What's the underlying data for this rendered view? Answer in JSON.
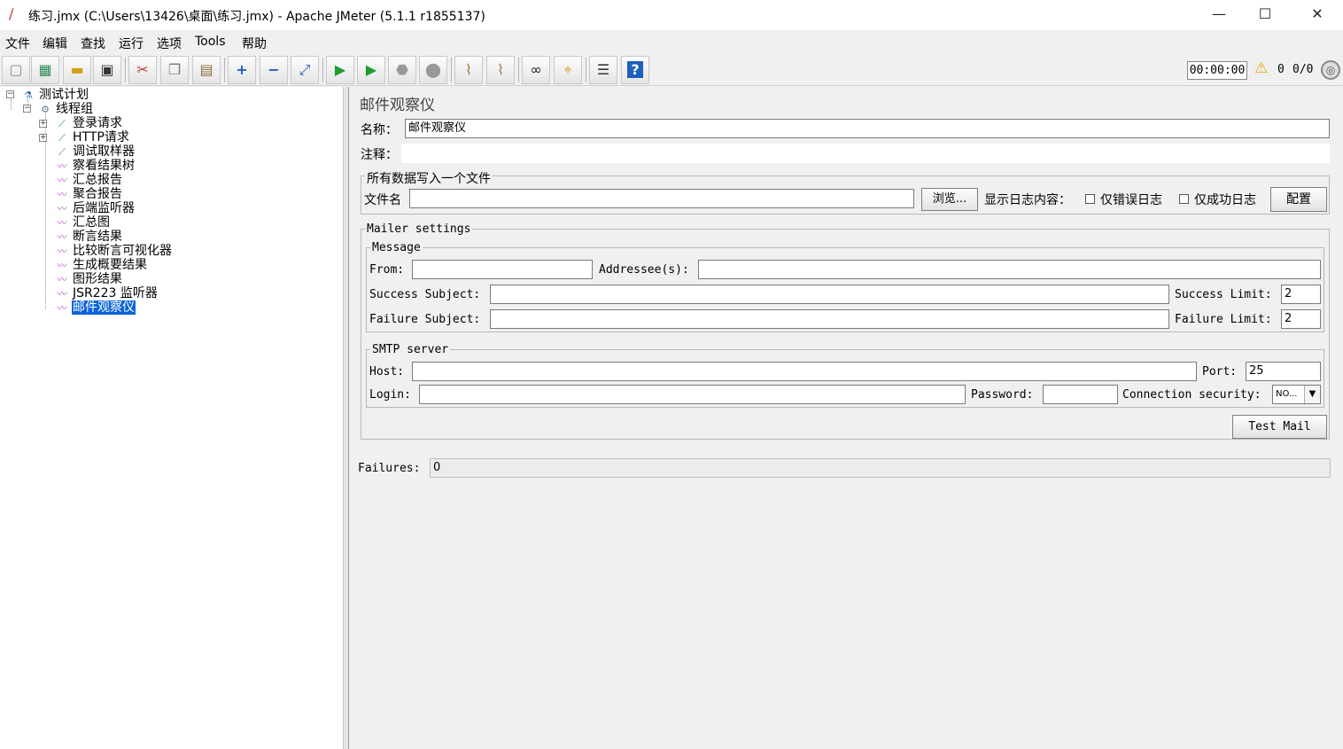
{
  "window": {
    "title": "练习.jmx (C:\\Users\\13426\\桌面\\练习.jmx) - Apache JMeter (5.1.1 r1855137)",
    "minimize": "—",
    "maximize": "☐",
    "close": "✕"
  },
  "menu": [
    "文件",
    "编辑",
    "查找",
    "运行",
    "选项",
    "Tools",
    "帮助"
  ],
  "toolbar": {
    "buttons": [
      {
        "name": "new-icon",
        "glyph": "📄"
      },
      {
        "name": "templates-icon",
        "glyph": "📗"
      },
      {
        "name": "open-icon",
        "glyph": "📂"
      },
      {
        "name": "save-icon",
        "glyph": "💾"
      },
      {
        "name": "cut-icon",
        "glyph": "✂"
      },
      {
        "name": "copy-icon",
        "glyph": "❐"
      },
      {
        "name": "paste-icon",
        "glyph": "📋"
      },
      {
        "name": "expand-icon",
        "glyph": "+"
      },
      {
        "name": "collapse-icon",
        "glyph": "−"
      },
      {
        "name": "toggle-icon",
        "glyph": "⤢"
      },
      {
        "name": "start-icon",
        "glyph": "▶"
      },
      {
        "name": "start-no-pause-icon",
        "glyph": "▶"
      },
      {
        "name": "stop-icon",
        "glyph": "⏹"
      },
      {
        "name": "shutdown-icon",
        "glyph": "✖"
      },
      {
        "name": "clear-icon",
        "glyph": "🧹"
      },
      {
        "name": "clear-all-icon",
        "glyph": "🧹"
      },
      {
        "name": "search-icon",
        "glyph": "🔍"
      },
      {
        "name": "reset-search-icon",
        "glyph": "🧽"
      },
      {
        "name": "function-helper-icon",
        "glyph": "☰"
      },
      {
        "name": "help-icon",
        "glyph": "?"
      }
    ],
    "timer": "00:00:00",
    "warning_count": "0",
    "thread_count": "0/0"
  },
  "tree": {
    "items": [
      {
        "label": "测试计划",
        "name": "tree-item-test-plan",
        "icon": "flask-icon"
      },
      {
        "label": "线程组",
        "name": "tree-item-thread-group",
        "icon": "gear-icon"
      },
      {
        "label": "登录请求",
        "name": "tree-item-login-request",
        "icon": "pipette-icon"
      },
      {
        "label": "HTTP请求",
        "name": "tree-item-http-request",
        "icon": "pipette-icon"
      },
      {
        "label": "调试取样器",
        "name": "tree-item-debug-sampler",
        "icon": "pipette-icon"
      },
      {
        "label": "察看结果树",
        "name": "tree-item-view-results-tree",
        "icon": "chart-icon"
      },
      {
        "label": "汇总报告",
        "name": "tree-item-summary-report",
        "icon": "chart-icon"
      },
      {
        "label": "聚合报告",
        "name": "tree-item-aggregate-report",
        "icon": "chart-icon"
      },
      {
        "label": "后端监听器",
        "name": "tree-item-backend-listener",
        "icon": "chart-icon"
      },
      {
        "label": "汇总图",
        "name": "tree-item-aggregate-graph",
        "icon": "chart-icon"
      },
      {
        "label": "断言结果",
        "name": "tree-item-assertion-results",
        "icon": "chart-icon"
      },
      {
        "label": "比较断言可视化器",
        "name": "tree-item-compare-assertion",
        "icon": "chart-icon"
      },
      {
        "label": "生成概要结果",
        "name": "tree-item-summary-results",
        "icon": "chart-icon"
      },
      {
        "label": "图形结果",
        "name": "tree-item-graph-results",
        "icon": "chart-icon"
      },
      {
        "label": "JSR223 监听器",
        "name": "tree-item-jsr223-listener",
        "icon": "chart-icon"
      },
      {
        "label": "邮件观察仪",
        "name": "tree-item-mailer-visualizer",
        "icon": "chart-icon"
      }
    ]
  },
  "panel": {
    "title": "邮件观察仪",
    "name_label": "名称：",
    "name_value": "邮件观察仪",
    "comment_label": "注释：",
    "comment_value": "",
    "file_group": "所有数据写入一个文件",
    "filename_label": "文件名",
    "filename_value": "",
    "browse": "浏览...",
    "log_content_label": "显示日志内容：",
    "errors_only": "仅错误日志",
    "successes_only": "仅成功日志",
    "configure": "配置",
    "mailer_settings": "Mailer settings",
    "message_group": "Message",
    "from_label": "From:",
    "from_value": "",
    "addressee_label": "Addressee(s):",
    "addressee_value": "",
    "success_subject_label": "Success Subject:",
    "success_subject_value": "",
    "success_limit_label": "Success Limit:",
    "success_limit_value": "2",
    "failure_subject_label": "Failure Subject:",
    "failure_subject_value": "",
    "failure_limit_label": "Failure Limit:",
    "failure_limit_value": "2",
    "smtp_group": "SMTP server",
    "host_label": "Host:",
    "host_value": "",
    "port_label": "Port:",
    "port_value": "25",
    "login_label": "Login:",
    "login_value": "",
    "password_label": "Password:",
    "password_value": "",
    "security_label": "Connection security:",
    "security_value": "NO...",
    "test_mail": "Test Mail",
    "failures_label": "Failures:",
    "failures_value": "0"
  }
}
